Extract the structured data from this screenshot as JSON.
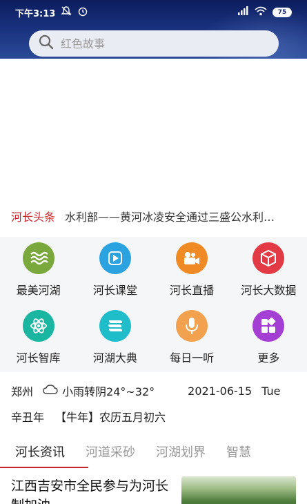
{
  "status_bar": {
    "time": "下午3:13",
    "battery": "75"
  },
  "search": {
    "placeholder": "红色故事"
  },
  "headline": {
    "tag": "河长头条",
    "text": "水利部——黄河冰凌安全通过三盛公水利…"
  },
  "grid": [
    {
      "label": "最美河湖",
      "icon": "waves-icon",
      "color": "#7aa83c"
    },
    {
      "label": "河长课堂",
      "icon": "play-icon",
      "color": "#2aa3e0"
    },
    {
      "label": "河长直播",
      "icon": "video-camera-icon",
      "color": "#f08a24"
    },
    {
      "label": "河长大数据",
      "icon": "cube-icon",
      "color": "#e23b45"
    },
    {
      "label": "河长智库",
      "icon": "atom-icon",
      "color": "#1bb6a2"
    },
    {
      "label": "河湖大典",
      "icon": "book-icon",
      "color": "#1fbcc9"
    },
    {
      "label": "每日一听",
      "icon": "microphone-icon",
      "color": "#f2a24f"
    },
    {
      "label": "更多",
      "icon": "apps-icon",
      "color": "#a33fd2"
    }
  ],
  "weather": {
    "city": "郑州",
    "condition": "小雨转阴24°~32°",
    "date": "2021-06-15",
    "weekday": "Tue"
  },
  "lunar": {
    "year": "辛丑年",
    "zodiac": "【牛年】农历五月初六"
  },
  "tabs": [
    "河长资讯",
    "河道采砂",
    "河湖划界",
    "智慧"
  ],
  "news": {
    "title": "江西吉安市全民参与为河长制加油"
  },
  "colors": {
    "accent": "#c8252b",
    "header": "#18307c"
  }
}
